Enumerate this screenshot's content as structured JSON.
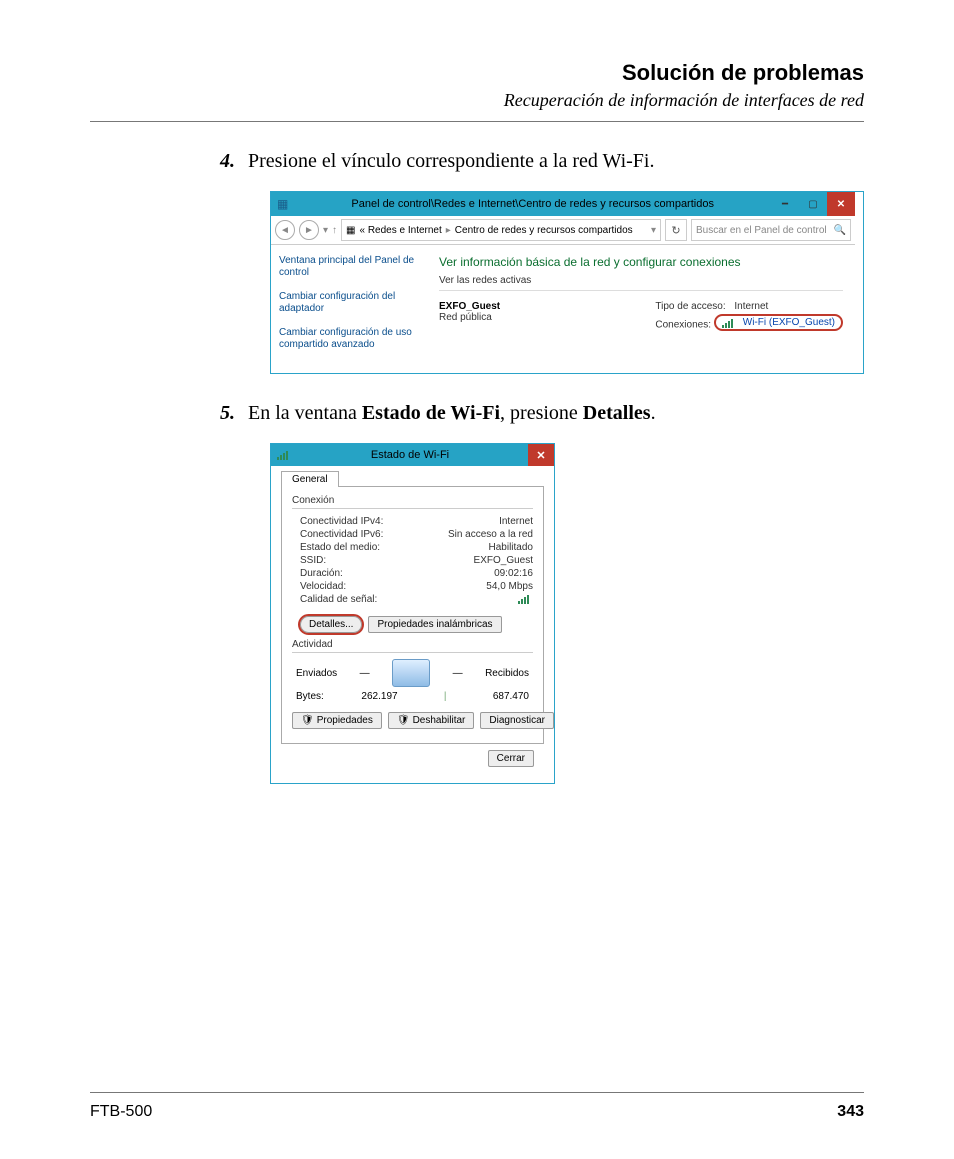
{
  "header": {
    "title": "Solución de problemas",
    "subtitle": "Recuperación de información de interfaces de red"
  },
  "steps": {
    "s4": {
      "num": "4.",
      "text_a": "Presione el vínculo correspondiente a la red Wi-Fi."
    },
    "s5": {
      "num": "5.",
      "text_a": "En la ventana ",
      "bold1": "Estado de Wi-Fi",
      "text_b": ", presione ",
      "bold2": "Detalles",
      "text_c": "."
    }
  },
  "cp": {
    "title": "Panel de control\\Redes e Internet\\Centro de redes y recursos compartidos",
    "path_prefix": "« Redes e Internet",
    "path_last": "Centro de redes y recursos compartidos",
    "search_placeholder": "Buscar en el Panel de control",
    "side1": "Ventana principal del Panel de control",
    "side2": "Cambiar configuración del adaptador",
    "side3": "Cambiar configuración de uso compartido avanzado",
    "main_head": "Ver información básica de la red y configurar conexiones",
    "main_sub": "Ver las redes activas",
    "net_name": "EXFO_Guest",
    "net_type": "Red pública",
    "access_label": "Tipo de acceso:",
    "access_value": "Internet",
    "conn_label": "Conexiones:",
    "conn_value": "Wi-Fi (EXFO_Guest)"
  },
  "dlg": {
    "title": "Estado de Wi-Fi",
    "tab": "General",
    "grp_conexion": "Conexión",
    "rows": {
      "ipv4": {
        "k": "Conectividad IPv4:",
        "v": "Internet"
      },
      "ipv6": {
        "k": "Conectividad IPv6:",
        "v": "Sin acceso a la red"
      },
      "medio": {
        "k": "Estado del medio:",
        "v": "Habilitado"
      },
      "ssid": {
        "k": "SSID:",
        "v": "EXFO_Guest"
      },
      "dur": {
        "k": "Duración:",
        "v": "09:02:16"
      },
      "vel": {
        "k": "Velocidad:",
        "v": "54,0 Mbps"
      },
      "cal": {
        "k": "Calidad de señal:",
        "v": ""
      }
    },
    "btn_detalles": "Detalles...",
    "btn_propinal": "Propiedades inalámbricas",
    "grp_act": "Actividad",
    "sent": "Enviados",
    "recv": "Recibidos",
    "bytes_label": "Bytes:",
    "bytes_sent": "262.197",
    "bytes_recv": "687.470",
    "btn_prop": "Propiedades",
    "btn_deshab": "Deshabilitar",
    "btn_diag": "Diagnosticar",
    "btn_cerrar": "Cerrar"
  },
  "footer": {
    "model": "FTB-500",
    "page": "343"
  }
}
